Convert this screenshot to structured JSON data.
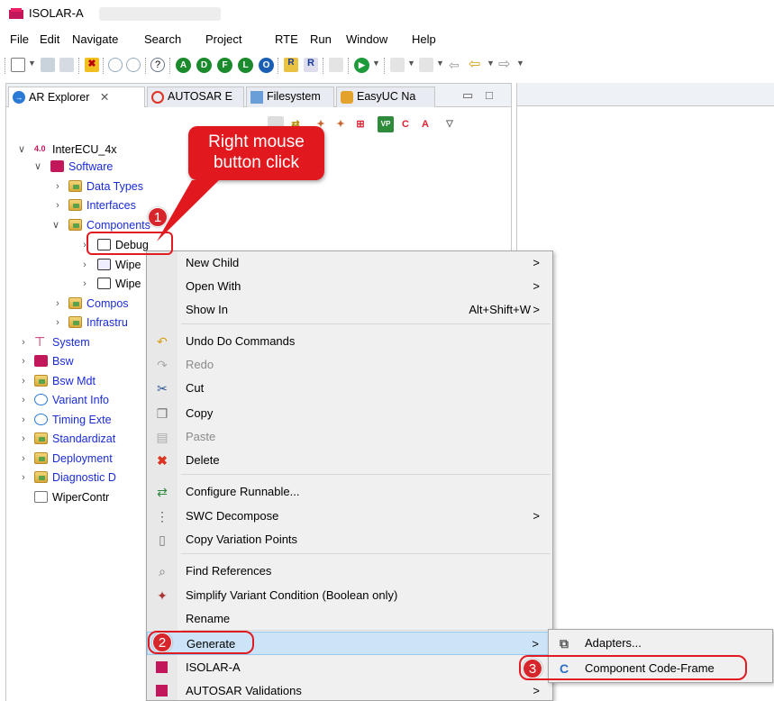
{
  "window": {
    "title": "ISOLAR-A"
  },
  "menubar": [
    "File",
    "Edit",
    "Navigate",
    "Search",
    "Project",
    "RTE",
    "Run",
    "Window",
    "Help"
  ],
  "tabs": [
    {
      "label": "AR Explorer",
      "close": "✕"
    },
    {
      "label": "AUTOSAR E"
    },
    {
      "label": "Filesystem"
    },
    {
      "label": "EasyUC Na"
    }
  ],
  "tree": {
    "root": "InterECU_4x",
    "software": "Software",
    "data_types": "Data Types",
    "interfaces": "Interfaces",
    "components": "Components",
    "debug": "Debug",
    "wipe1": "Wipe",
    "wipe2": "Wipe",
    "compos": "Compos",
    "infrastru": "Infrastru",
    "system": "System",
    "bsw": "Bsw",
    "bsw_mdt": "Bsw Mdt",
    "variant_info": "Variant Info",
    "timing_exte": "Timing Exte",
    "standardizat": "Standardizat",
    "deployment": "Deployment",
    "diagnostic": "Diagnostic D",
    "wipercontr": "WiperContr"
  },
  "context_menu": {
    "new_child": "New Child",
    "open_with": "Open With",
    "show_in": "Show In",
    "show_in_shortcut": "Alt+Shift+W",
    "undo": "Undo Do Commands",
    "redo": "Redo",
    "cut": "Cut",
    "copy": "Copy",
    "paste": "Paste",
    "delete": "Delete",
    "configure_runnable": "Configure Runnable...",
    "swc_decompose": "SWC Decompose",
    "copy_variation": "Copy Variation Points",
    "find_refs": "Find References",
    "simplify": "Simplify Variant Condition (Boolean only)",
    "rename": "Rename",
    "generate": "Generate",
    "isolar": "ISOLAR-A",
    "autosar_validations": "AUTOSAR Validations",
    "arrow": ">"
  },
  "submenu": {
    "adapters": "Adapters...",
    "code_frame": "Component Code-Frame"
  },
  "annotations": {
    "callout": "Right mouse button click",
    "step1": "1",
    "step2": "2",
    "step3": "3"
  },
  "colors": {
    "accent_red": "#e11b22",
    "highlight": "#cce4f7",
    "link": "#1a2bd8"
  }
}
